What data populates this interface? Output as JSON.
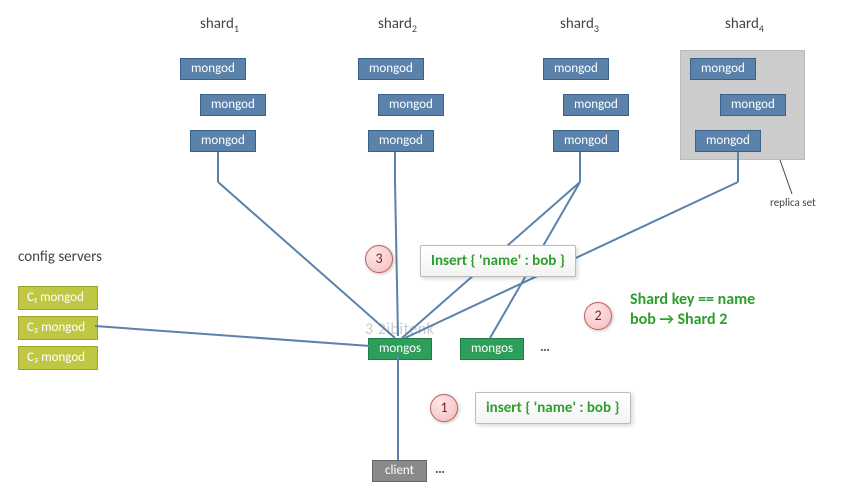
{
  "shards": {
    "labels": [
      "shard",
      "shard",
      "shard",
      "shard"
    ],
    "subs": [
      "1",
      "2",
      "3",
      "4"
    ],
    "node": "mongod"
  },
  "replicaSetLabel": "replica set",
  "configServers": {
    "heading": "config servers",
    "items": [
      "C₁ mongod",
      "C₂ mongod",
      "C₃ mongod"
    ]
  },
  "mongos": {
    "label": "mongos"
  },
  "client": {
    "label": "client"
  },
  "ellipsis": "…",
  "steps": {
    "one": "1",
    "two": "2",
    "three": "3"
  },
  "callouts": {
    "c3": "Insert { 'name' : bob }",
    "c2_line1": "Shard key == name",
    "c2_line2": "bob → Shard 2",
    "c1": "insert { 'name' : bob }"
  },
  "watermark": "3 2ibitenk"
}
